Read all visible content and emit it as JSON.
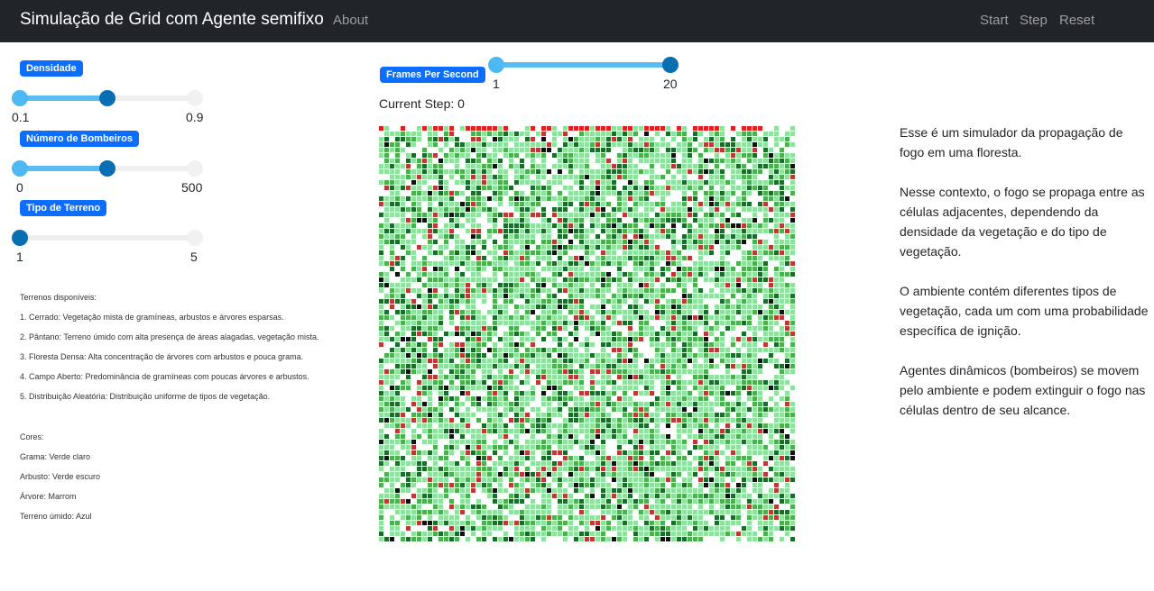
{
  "navbar": {
    "brand": "Simulação de Grid com Agente semifixo",
    "about": "About",
    "start": "Start",
    "step": "Step",
    "reset": "Reset"
  },
  "controls": {
    "density": {
      "label": "Densidade",
      "min_label": "0.1",
      "max_label": "0.9",
      "level": 0.5
    },
    "firefighters": {
      "label": "Número de Bombeiros",
      "min_label": "0",
      "max_label": "500",
      "level": 0.5
    },
    "terrain": {
      "label": "Tipo de Terreno",
      "min_label": "1",
      "max_label": "5",
      "level": 0.0
    },
    "fps": {
      "label": "Frames Per Second",
      "min_label": "1",
      "max_label": "20",
      "level": 1.0
    }
  },
  "current_step": "Current Step: 0",
  "legend": {
    "terrains_title": "Terrenos disponíveis:",
    "terrains": [
      "1. Cerrado: Vegetação mista de gramíneas, arbustos e árvores esparsas.",
      "2. Pântano: Terreno úmido com alta presença de áreas alagadas, vegetação mista.",
      "3. Floresta Densa: Alta concentração de árvores com arbustos e pouca grama.",
      "4. Campo Aberto: Predominância de gramíneas com poucas árvores e arbustos.",
      "5. Distribuição Aleatória: Distribuição uniforme de tipos de vegetação."
    ],
    "colors_title": "Cores:",
    "colors": [
      "Grama: Verde claro",
      "Arbusto: Verde escuro",
      "Árvore: Marrom",
      "Terreno úmido: Azul"
    ]
  },
  "description": [
    "Esse é um simulador da propagação de fogo em uma floresta.",
    "Nesse contexto, o fogo se propaga entre as células adjacentes, dependendo da densidade da vegetação e do tipo de vegetação.",
    "O ambiente contém diferentes tipos de vegetação, cada um com uma probabilidade específica de ignição.",
    "Agentes dinâmicos (bombeiros) se movem pelo ambiente e podem extinguir o fogo nas células dentro de seu alcance."
  ],
  "grid": {
    "palette": [
      "#ffffff",
      "#90e0a0",
      "#4caf50",
      "#1e6b2e",
      "#b83a3a",
      "#111111",
      "#e02020"
    ]
  }
}
